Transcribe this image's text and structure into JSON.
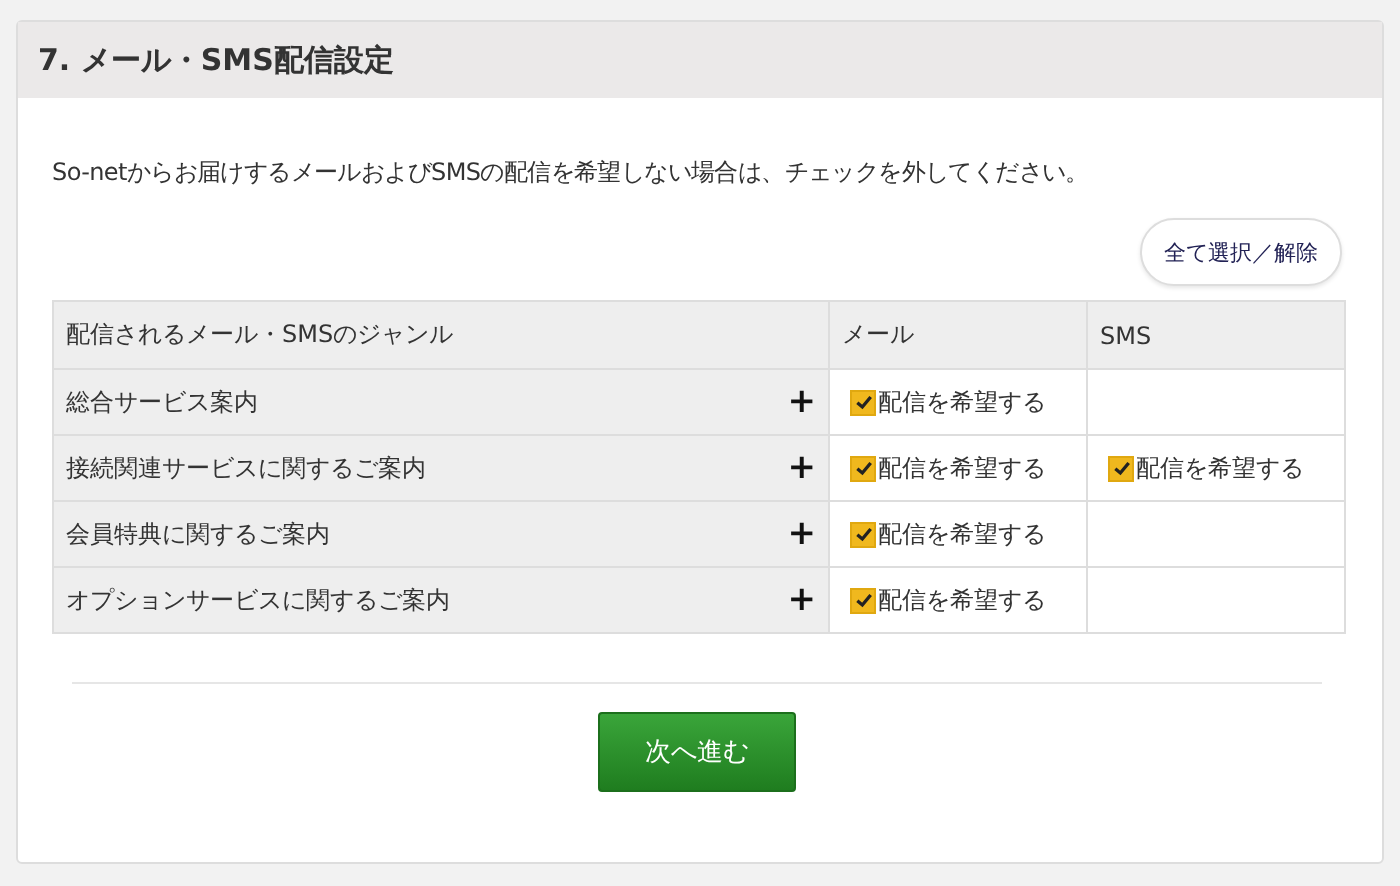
{
  "section": {
    "title": "7. メール・SMS配信設定"
  },
  "notice": "So-netからお届けするメールおよびSMSの配信を希望しない場合は、チェックを外してください。",
  "select_all_button": "全て選択／解除",
  "table": {
    "columns": [
      "配信されるメール・SMSのジャンル",
      "メール",
      "SMS"
    ],
    "rows": [
      {
        "genre": "総合サービス案内",
        "expand": "+",
        "mail": {
          "label": "配信を希望する",
          "checked": true
        }
      },
      {
        "genre": "接続関連サービスに関するご案内",
        "expand": "+",
        "mail": {
          "label": "配信を希望する",
          "checked": true
        },
        "sms": {
          "label": "配信を希望する",
          "checked": true
        }
      },
      {
        "genre": "会員特典に関するご案内",
        "expand": "+",
        "mail": {
          "label": "配信を希望する",
          "checked": true
        }
      },
      {
        "genre": "オプションサービスに関するご案内",
        "expand": "+",
        "mail": {
          "label": "配信を希望する",
          "checked": true
        }
      }
    ]
  },
  "next_button": "次へ進む"
}
